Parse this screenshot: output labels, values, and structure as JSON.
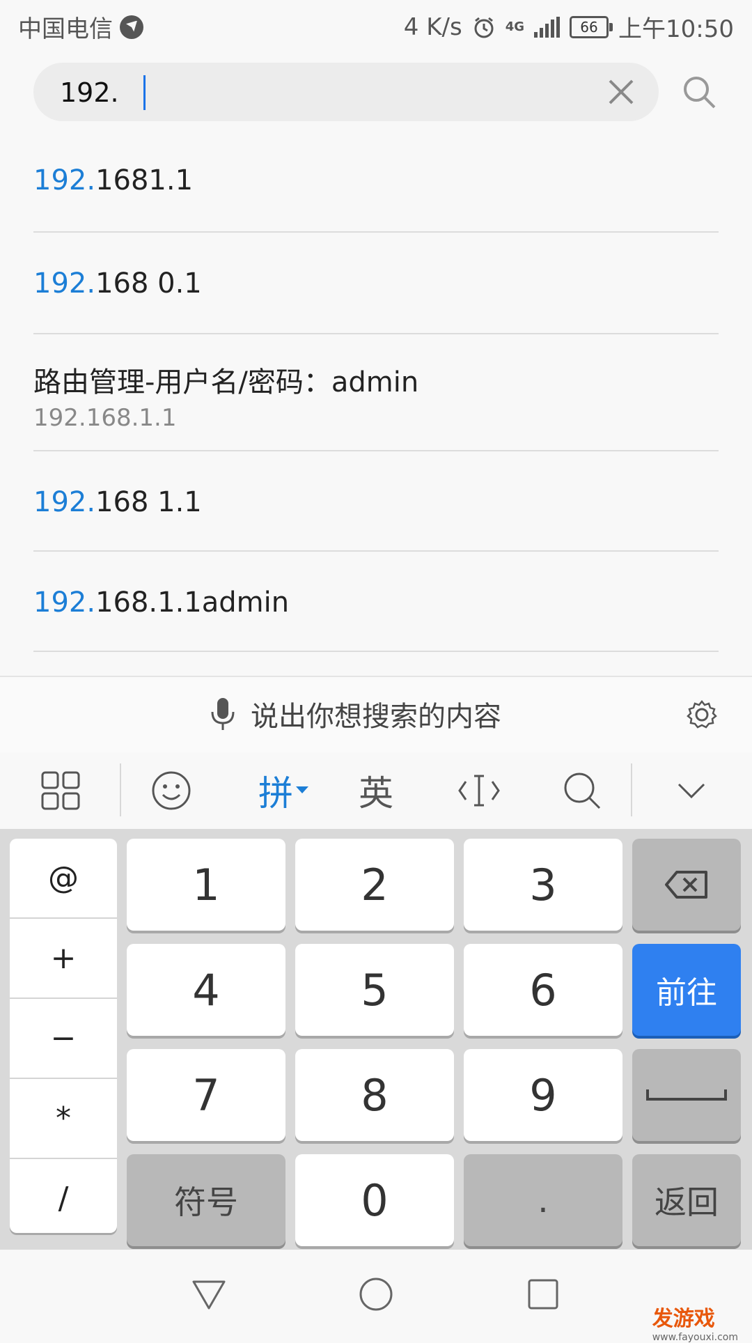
{
  "status_bar": {
    "carrier": "中国电信",
    "net_speed": "4 K/s",
    "network": "4G",
    "battery": "66",
    "time": "上午10:50"
  },
  "search": {
    "value": "192."
  },
  "suggestions": [
    {
      "highlight": "192.",
      "rest": "1681.1"
    },
    {
      "highlight": "192.",
      "rest": "168 0.1"
    },
    {
      "title": "路由管理-用户名/密码：admin",
      "url": "192.168.1.1"
    },
    {
      "highlight": "192.",
      "rest": "168 1.1"
    },
    {
      "highlight": "192.",
      "rest": "168.1.1admin"
    }
  ],
  "voice": {
    "prompt": "说出你想搜索的内容"
  },
  "ime_toolbar": {
    "pinyin": "拼",
    "english": "英"
  },
  "keyboard": {
    "symbols": [
      "@",
      "+",
      "−",
      "*",
      "/"
    ],
    "digits": [
      "1",
      "2",
      "3",
      "4",
      "5",
      "6",
      "7",
      "8",
      "9",
      "0"
    ],
    "symbol_key": "符号",
    "dot_key": ".",
    "go_key": "前往",
    "return_key": "返回"
  },
  "watermark": {
    "brand": "发游戏",
    "url": "www.fayouxi.com"
  },
  "colors": {
    "accent": "#1c7ed6",
    "go_key": "#2f80f0"
  }
}
